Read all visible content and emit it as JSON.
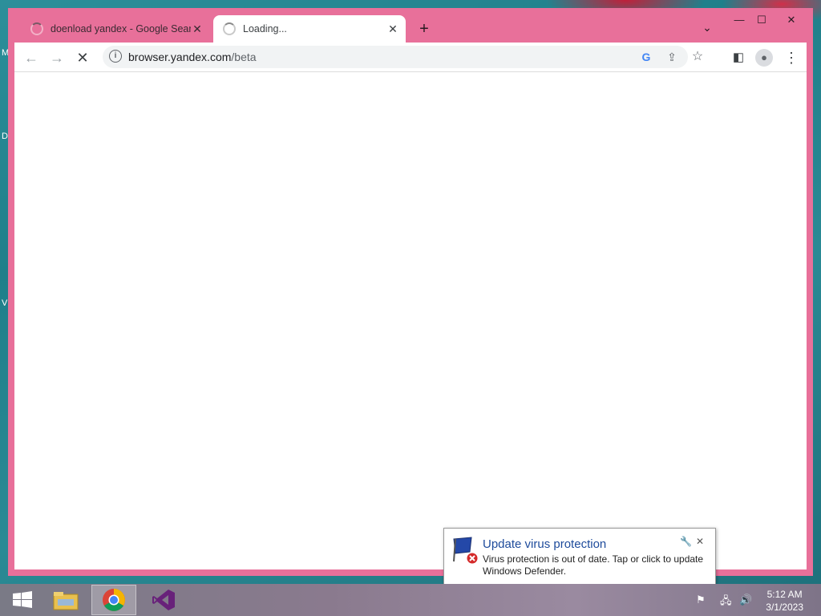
{
  "browser": {
    "tabs": [
      {
        "title": "doenload yandex - Google Searc",
        "state": "loading"
      },
      {
        "title": "Loading...",
        "state": "loading",
        "active": true
      }
    ],
    "new_tab_label": "+",
    "address": {
      "host": "browser.yandex.com",
      "path": "/beta"
    },
    "window_controls": {
      "minimize": "—",
      "maximize": "☐",
      "close": "✕"
    }
  },
  "desktop_letters": [
    "M",
    "D",
    "V"
  ],
  "notification": {
    "title": "Update virus protection",
    "body": "Virus protection is out of date. Tap or click to update Windows Defender."
  },
  "taskbar": {
    "apps": [
      "start",
      "file-explorer",
      "chrome",
      "visual-studio"
    ],
    "time": "5:12 AM",
    "date": "3/1/2023"
  },
  "colors": {
    "window_frame": "#e8709a",
    "accent_blue": "#1e4b9b"
  }
}
